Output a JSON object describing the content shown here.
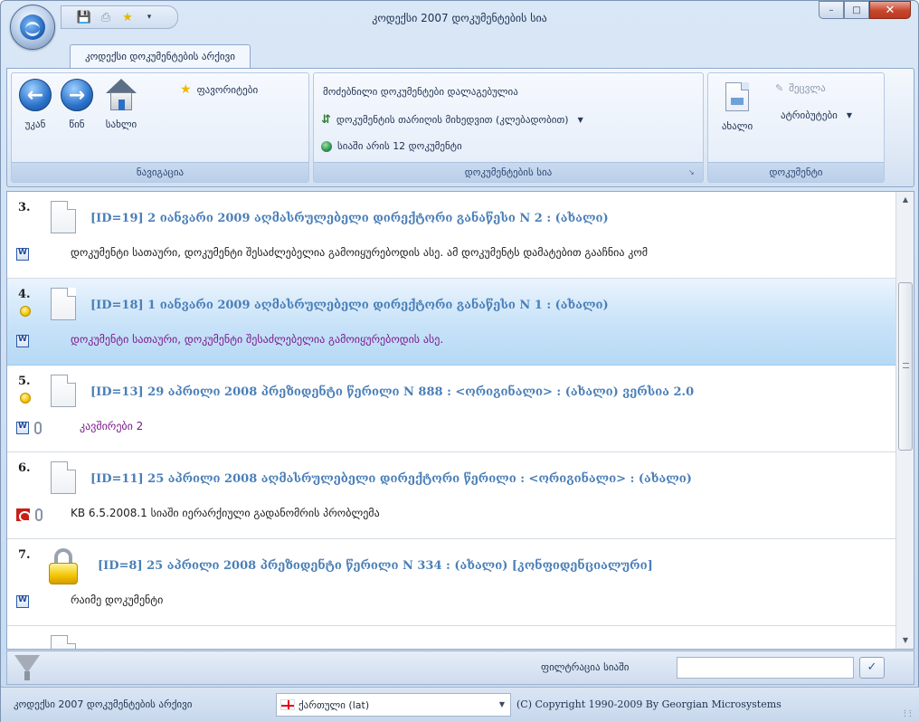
{
  "window": {
    "title": "კოდექსი 2007 დოკუმენტების სია",
    "minimize_icon": "minimize-icon",
    "maximize_icon": "maximize-icon",
    "close_icon": "close-icon"
  },
  "ribbon": {
    "tab": "კოდექსი დოკუმენტების არქივი",
    "navigation": {
      "label": "ნავიგაცია",
      "back": "უკან",
      "forward": "წინ",
      "home": "სახლი",
      "favorites": "ფავორიტები"
    },
    "doc_list": {
      "label": "დოკუმენტების სია",
      "sorted_text": "მოძებნილი დოკუმენტები დალაგებულია",
      "sort_by": "დოკუმენტის თარიღის მიხედვით (კლებადობით)",
      "count_text": "სიაში არის 12 დოკუმენტი"
    },
    "document": {
      "label": "დოკუმენტი",
      "new": "ახალი",
      "edit": "შეცვლა",
      "attributes": "ატრიბუტები"
    }
  },
  "list": {
    "items": [
      {
        "num": "3.",
        "title": "[ID=19] 2 იანვარი 2009  აღმასრულებელი დირექტორი  განაწესი N 2 : (ახალი)",
        "sub": "დოკუმენტი სათაური, დოკუმენტი შესაძლებელია გამოიყურებოდის ასე.  ამ დოკუმენტს დამატებით გააჩნია  კომ"
      },
      {
        "num": "4.",
        "title": "[ID=18] 1 იანვარი 2009  აღმასრულებელი დირექტორი  განაწესი N 1 : (ახალი)",
        "sub": "დოკუმენტი სათაური, დოკუმენტი შესაძლებელია გამოიყურებოდის ასე."
      },
      {
        "num": "5.",
        "title": "[ID=13] 29 აპრილი 2008  პრეზიდენტი  წერილი N 888 : <ორიგინალი>  : (ახალი)  ვერსია 2.0",
        "sub": "კავშირები 2"
      },
      {
        "num": "6.",
        "title": "[ID=11] 25 აპრილი 2008  აღმასრულებელი დირექტორი  წერილი  : <ორიგინალი>  : (ახალი)",
        "sub": "KB 6.5.2008.1 სიაში იერარქიული გადანომრის პრობლემა"
      },
      {
        "num": "7.",
        "title": "[ID=8] 25 აპრილი 2008  პრეზიდენტი  წერილი N 334 : (ახალი)  [კონფიდენციალური]",
        "sub": "რაიმე დოკუმენტი"
      }
    ]
  },
  "filter": {
    "label": "ფილტრაცია სიაში",
    "value": "",
    "go_icon": "checkmark-icon"
  },
  "status": {
    "archive": "კოდექსი 2007 დოკუმენტების არქივი",
    "language": "ქართული (lat)",
    "copyright": "(C) Copyright 1990-2009 By Georgian Microsystems"
  }
}
